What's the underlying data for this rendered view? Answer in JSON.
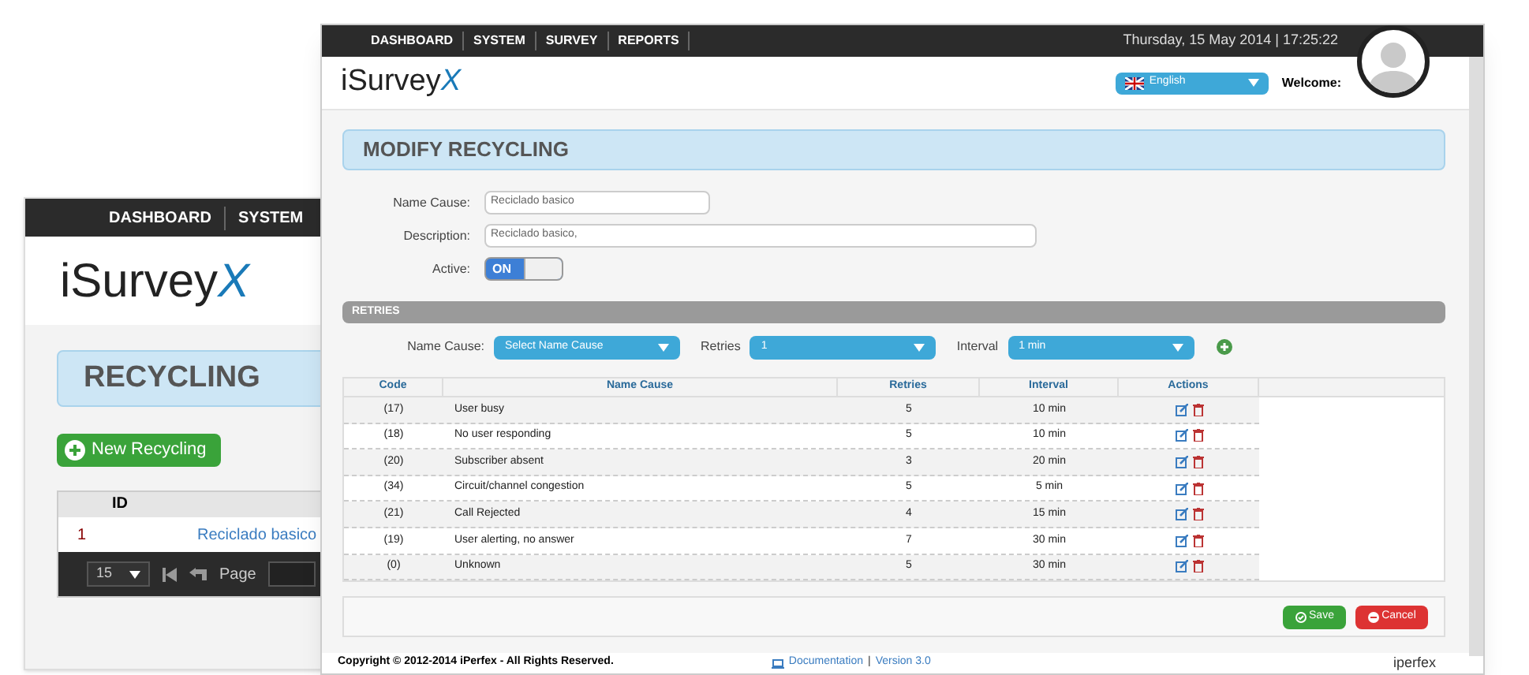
{
  "back_window": {
    "nav": [
      "DASHBOARD",
      "SYSTEM"
    ],
    "logo": "iSurveyX",
    "title": "RECYCLING",
    "new_button": "New Recycling",
    "table": {
      "columns": [
        "ID"
      ],
      "rows": [
        {
          "id": "1",
          "name": "Reciclado basico"
        }
      ]
    },
    "pager": {
      "page_size": "15",
      "page_label": "Page"
    }
  },
  "front_window": {
    "nav": [
      "DASHBOARD",
      "SYSTEM",
      "SURVEY",
      "REPORTS"
    ],
    "datetime": "Thursday, 15 May 2014 | 17:25:22",
    "logo": "iSurveyX",
    "language": "English",
    "welcome": "Welcome:",
    "title": "MODIFY RECYCLING",
    "fields": [
      {
        "label": "Name Cause:",
        "value": "Reciclado basico",
        "wide": false
      },
      {
        "label": "Description:",
        "value": "Reciclado basico,",
        "wide": true
      }
    ],
    "active": {
      "label": "Active:",
      "on": true,
      "on_text": "ON"
    },
    "section": "RETRIES",
    "filters": [
      {
        "label": "Name Cause:",
        "value": "Select Name Cause"
      },
      {
        "label": "Retries",
        "value": "1"
      },
      {
        "label": "Interval",
        "value": "1 min"
      }
    ],
    "table": {
      "columns": [
        "Code",
        "Name Cause",
        "Retries",
        "Interval",
        "Actions"
      ],
      "rows": [
        {
          "code": "(17)",
          "name": "User busy",
          "retries": "5",
          "interval": "10 min"
        },
        {
          "code": "(18)",
          "name": "No user responding",
          "retries": "5",
          "interval": "10 min"
        },
        {
          "code": "(20)",
          "name": "Subscriber absent",
          "retries": "3",
          "interval": "20 min"
        },
        {
          "code": "(34)",
          "name": "Circuit/channel congestion",
          "retries": "5",
          "interval": "5 min"
        },
        {
          "code": "(21)",
          "name": "Call Rejected",
          "retries": "4",
          "interval": "15 min"
        },
        {
          "code": "(19)",
          "name": "User alerting, no answer",
          "retries": "7",
          "interval": "30 min"
        },
        {
          "code": "(0)",
          "name": "Unknown",
          "retries": "5",
          "interval": "30 min"
        }
      ]
    },
    "buttons": {
      "save": "Save",
      "cancel": "Cancel"
    },
    "footer": {
      "copyright": "Copyright © 2012-2014 iPerfex - All Rights Reserved.",
      "documentation": "Documentation",
      "separator": "|",
      "version": "Version 3.0",
      "brand": "iperfex"
    }
  }
}
